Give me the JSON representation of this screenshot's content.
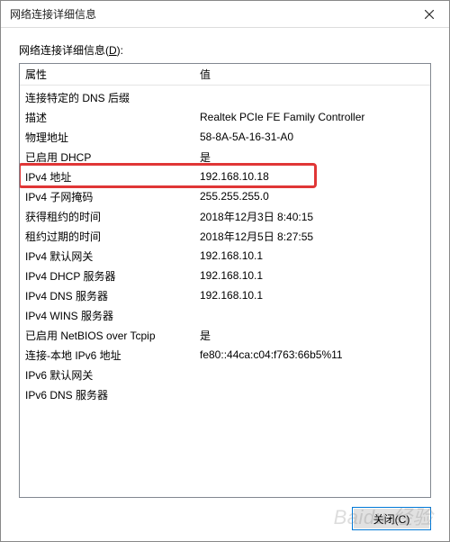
{
  "window": {
    "title": "网络连接详细信息"
  },
  "section_label_prefix": "网络连接详细信息(",
  "section_label_mnemonic": "D",
  "section_label_suffix": "):",
  "columns": {
    "property": "属性",
    "value": "值"
  },
  "rows": [
    {
      "prop": "连接特定的 DNS 后缀",
      "val": ""
    },
    {
      "prop": "描述",
      "val": "Realtek PCIe FE Family Controller"
    },
    {
      "prop": "物理地址",
      "val": "58-8A-5A-16-31-A0"
    },
    {
      "prop": "已启用 DHCP",
      "val": "是"
    },
    {
      "prop": "IPv4 地址",
      "val": "192.168.10.18",
      "highlight": true
    },
    {
      "prop": "IPv4 子网掩码",
      "val": "255.255.255.0"
    },
    {
      "prop": "获得租约的时间",
      "val": "2018年12月3日 8:40:15"
    },
    {
      "prop": "租约过期的时间",
      "val": "2018年12月5日 8:27:55"
    },
    {
      "prop": "IPv4 默认网关",
      "val": "192.168.10.1"
    },
    {
      "prop": "IPv4 DHCP 服务器",
      "val": "192.168.10.1"
    },
    {
      "prop": "IPv4 DNS 服务器",
      "val": "192.168.10.1"
    },
    {
      "prop": "IPv4 WINS 服务器",
      "val": ""
    },
    {
      "prop": "已启用 NetBIOS over Tcpip",
      "val": "是"
    },
    {
      "prop": "连接-本地 IPv6 地址",
      "val": "fe80::44ca:c04:f763:66b5%11"
    },
    {
      "prop": "IPv6 默认网关",
      "val": ""
    },
    {
      "prop": "IPv6 DNS 服务器",
      "val": ""
    }
  ],
  "buttons": {
    "close": "关闭(C)"
  },
  "watermark": "Baidu 经验"
}
